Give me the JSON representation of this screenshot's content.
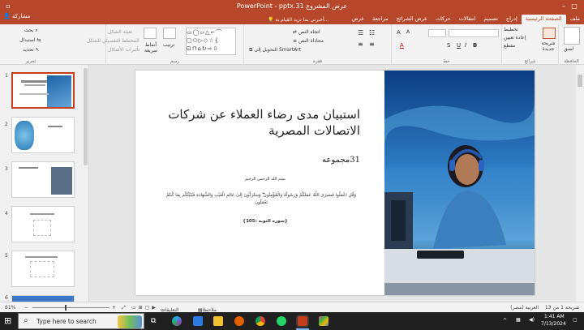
{
  "titlebar": {
    "title": "PowerPoint - pptx.31 عرض المشروع",
    "tell_me": "أخبرني بما تريد القيام به...",
    "share": "مشاركة",
    "tabs": [
      "ملف",
      "الصفحة الرئيسية",
      "إدراج",
      "تصميم",
      "انتقالات",
      "حركات",
      "عرض الشرائح",
      "مراجعة",
      "عرض"
    ]
  },
  "ribbon": {
    "clipboard": {
      "label": "الحافظة",
      "paste": "لصق"
    },
    "slides": {
      "label": "شرائح",
      "new_slide": "شريحة جديدة",
      "layout": "تخطيط",
      "reset": "إعادة تعيين",
      "section": "مقطع"
    },
    "font": {
      "label": "خط"
    },
    "paragraph": {
      "label": "فقرة",
      "text_direction": "اتجاه النص",
      "align_text": "محاذاة النص",
      "smartart": "التحويل إلى SmartArt"
    },
    "drawing": {
      "label": "رسم",
      "arrange": "ترتيب",
      "quick_styles": "أنماط سريعة",
      "fill": "تعبئة الشكل",
      "outline": "المخطط التفصيلي للشكل",
      "effects": "تأثيرات الأشكال"
    },
    "editing": {
      "label": "تحرير",
      "find": "بحث",
      "replace": "استبدال",
      "select": "تحديد"
    }
  },
  "slide": {
    "title": "استبيان مدى رضاء العملاء عن شركات الاتصالات المصرية",
    "subtitle": "31مجموعه",
    "bismillah": "بسم الله الرحمن الرحيم",
    "verse": "وَقُلِ اعْمَلُوا فَسَيَرَى اللَّهُ عَمَلَكُمْ وَرَسُولُهُ وَالْمُؤْمِنُونَ ۖ وَسَتُرَدُّونَ إِلَىٰ عَالِمِ الْغَيْبِ وَالشَّهَادَةِ فَيُنَبِّئُكُم بِمَا كُنتُمْ تَعْمَلُونَ",
    "reference": "{سوره التوبه :105}"
  },
  "thumbnails": [
    "1",
    "2",
    "3",
    "4",
    "5",
    "6"
  ],
  "status": {
    "slide_info": "شريحة 1 من 13",
    "language": "العربية (مصر)",
    "notes": "ملاحظات",
    "comments": "التعليقات",
    "zoom": "61%"
  },
  "taskbar": {
    "search_placeholder": "Type here to search",
    "time": "1:41 AM",
    "date": "7/13/2024"
  }
}
